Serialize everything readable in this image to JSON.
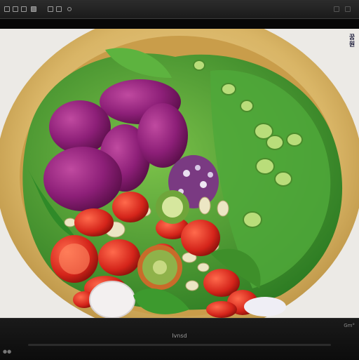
{
  "toolbar": {
    "icons": [
      "move-tool-icon",
      "select-tool-icon",
      "crop-tool-icon",
      "zoom-tool-icon",
      "hand-tool-icon",
      "layers-icon",
      "image-icon",
      "grid-icon",
      "settings-icon"
    ]
  },
  "canvas": {
    "subject": "salad-bowl-artwork",
    "side_mark": "꿈\n원"
  },
  "status": {
    "center_text": "Ivnsd",
    "right_text": "Gm°",
    "left_text": "●●"
  },
  "colors": {
    "chrome": "#1b1b1b",
    "canvas_bg": "#eceae6",
    "bowl": "#d7b56b",
    "lettuce": "#3f9a2c",
    "onion": "#8a1f72",
    "tomato": "#d6281e"
  }
}
